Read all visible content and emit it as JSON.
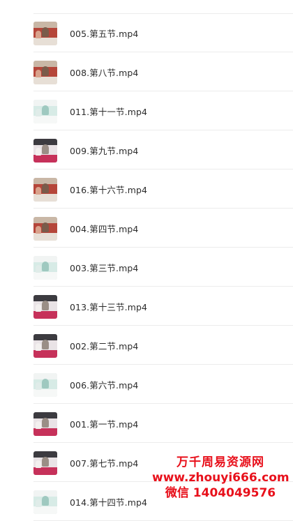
{
  "files": [
    {
      "name": "005.第五节.mp4",
      "thumb_style": "photo-warm",
      "icon": "video-thumbnail-icon"
    },
    {
      "name": "008.第八节.mp4",
      "thumb_style": "photo-warm",
      "icon": "video-thumbnail-icon"
    },
    {
      "name": "011.第十一节.mp4",
      "thumb_style": "slide-light",
      "icon": "video-thumbnail-icon"
    },
    {
      "name": "009.第九节.mp4",
      "thumb_style": "lecturer",
      "icon": "video-thumbnail-icon"
    },
    {
      "name": "016.第十六节.mp4",
      "thumb_style": "photo-warm",
      "icon": "video-thumbnail-icon"
    },
    {
      "name": "004.第四节.mp4",
      "thumb_style": "photo-warm",
      "icon": "video-thumbnail-icon"
    },
    {
      "name": "003.第三节.mp4",
      "thumb_style": "slide-light",
      "icon": "video-thumbnail-icon"
    },
    {
      "name": "013.第十三节.mp4",
      "thumb_style": "lecturer",
      "icon": "video-thumbnail-icon"
    },
    {
      "name": "002.第二节.mp4",
      "thumb_style": "lecturer",
      "icon": "video-thumbnail-icon"
    },
    {
      "name": "006.第六节.mp4",
      "thumb_style": "slide-light",
      "icon": "video-thumbnail-icon"
    },
    {
      "name": "001.第一节.mp4",
      "thumb_style": "lecturer",
      "icon": "video-thumbnail-icon"
    },
    {
      "name": "007.第七节.mp4",
      "thumb_style": "lecturer",
      "icon": "video-thumbnail-icon"
    },
    {
      "name": "014.第十四节.mp4",
      "thumb_style": "slide-light",
      "icon": "video-thumbnail-icon"
    }
  ],
  "watermark": {
    "title": "万千周易资源网",
    "url": "www.zhouyi666.com",
    "contact": "微信 1404049576",
    "color": "#e8101b"
  },
  "colors": {
    "divider": "#ececec",
    "text": "#2b2b2b",
    "background": "#ffffff"
  }
}
